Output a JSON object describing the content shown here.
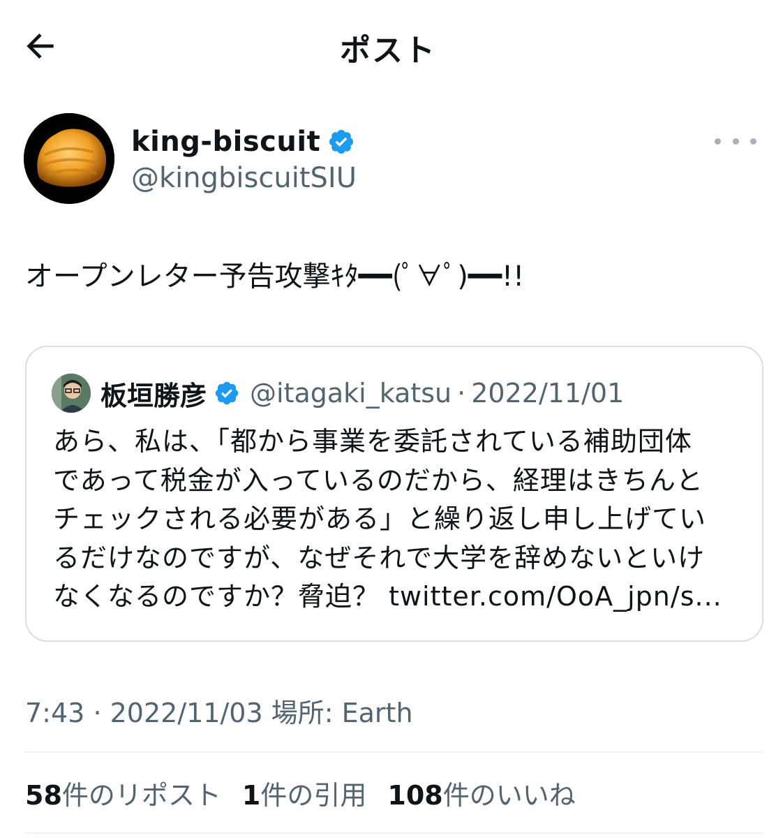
{
  "header": {
    "title": "ポスト",
    "back_icon": "arrow-left-icon"
  },
  "author": {
    "display_name": "king-biscuit",
    "handle": "@kingbiscuitSIU",
    "verified": true,
    "verified_color": "#1d9bf0",
    "more_icon": "more-horizontal-icon"
  },
  "post": {
    "text": "オープンレター予告攻撃ｷﾀ━━(ﾟ∀ﾟ)━━!!"
  },
  "quote": {
    "display_name": "板垣勝彦",
    "handle": "@itagaki_katsu",
    "separator": "·",
    "date": "2022/11/01",
    "verified": true,
    "lines": [
      "あら、私は、「都から事業を委託されている補助団体",
      "であって税金が入っているのだから、経理はきちんと",
      "チェックされる必要がある」と繰り返し申し上げてい",
      "るだけなのですが、なぜそれで大学を辞めないといけ",
      "なくなるのですか？脅迫？ twitter.com/OoA_jpn/s..."
    ]
  },
  "meta": {
    "time": "7:43",
    "separator": "·",
    "date": "2022/11/03",
    "location": "場所: Earth"
  },
  "stats": {
    "reposts_count": "58",
    "reposts_label": "件のリポスト",
    "quotes_count": "1",
    "quotes_label": "件の引用",
    "likes_count": "108",
    "likes_label": "件のいいね"
  },
  "colors": {
    "text_primary": "#0f1419",
    "text_secondary": "#536471",
    "border": "#d8dde2",
    "accent": "#1d9bf0"
  }
}
